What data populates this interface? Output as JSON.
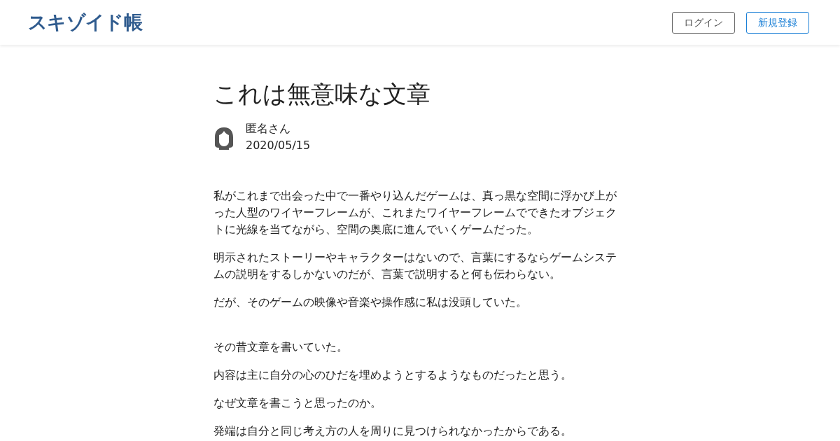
{
  "header": {
    "logo": "スキゾイド帳",
    "buttons": [
      {
        "label": "ログイン",
        "kind": "outline"
      },
      {
        "label": "新規登録",
        "kind": "primary"
      }
    ]
  },
  "article": {
    "title": "これは無意味な文章",
    "author": "匿名さん",
    "date": "2020/05/15",
    "sections": [
      {
        "paragraphs": [
          "私がこれまで出会った中で一番やり込んだゲームは、真っ黒な空間に浮かび上がった人型のワイヤーフレームが、これまたワイヤーフレームでできたオブジェクトに光線を当てながら、空間の奥底に進んでいくゲームだった。",
          "明示されたストーリーやキャラクターはないので、言葉にするならゲームシステムの説明をするしかないのだが、言葉で説明すると何も伝わらない。",
          "だが、そのゲームの映像や音楽や操作感に私は没頭していた。"
        ]
      },
      {
        "paragraphs": [
          "その昔文章を書いていた。",
          "内容は主に自分の心のひだを埋めようとするようなものだったと思う。",
          "なぜ文章を書こうと思ったのか。",
          "発端は自分と同じ考え方の人を周りに見つけられなかったからである。"
        ]
      }
    ]
  }
}
